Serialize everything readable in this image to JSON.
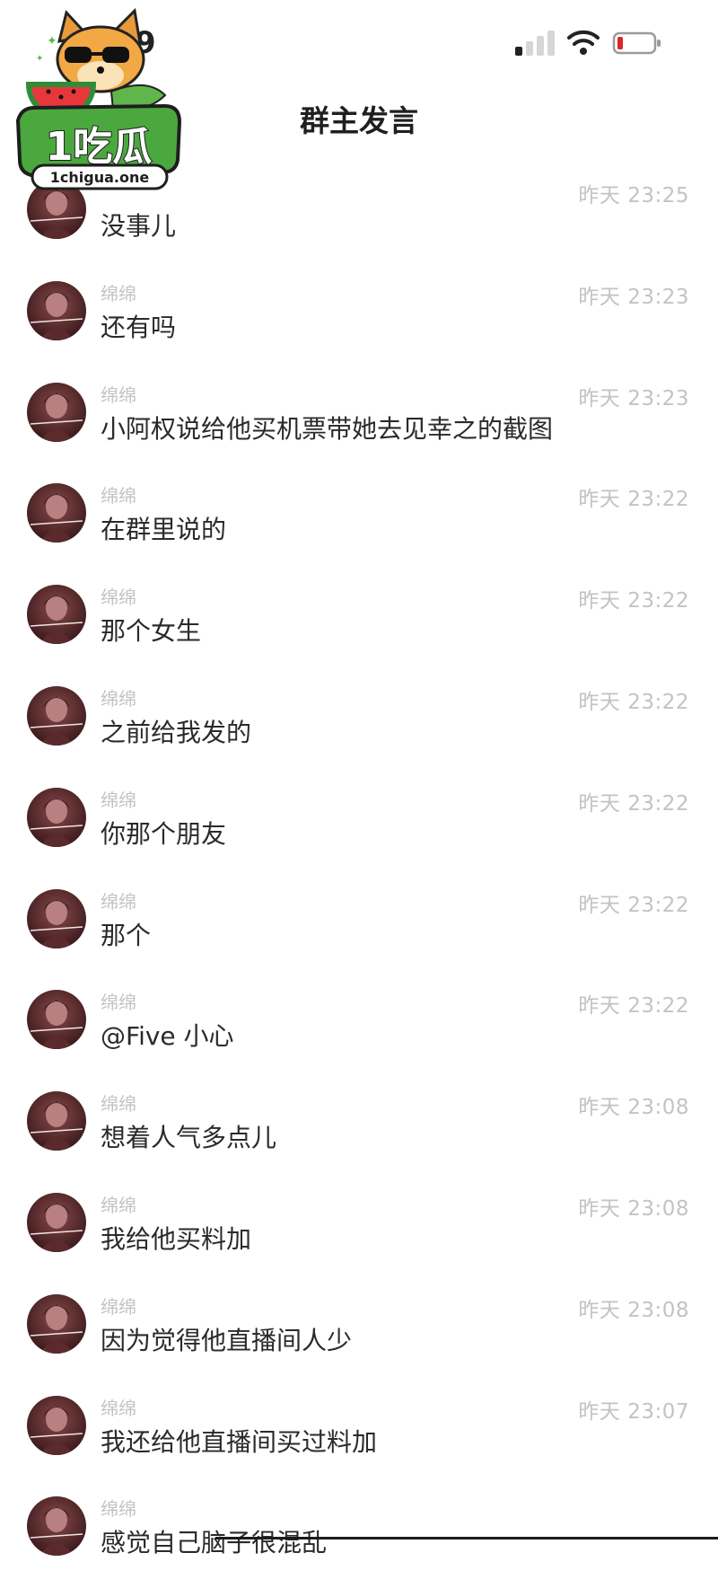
{
  "status_bar": {
    "time": "9"
  },
  "header": {
    "title": "群主发言"
  },
  "watermark": {
    "text": "1吃瓜",
    "url": "1chigua.one"
  },
  "messages": [
    {
      "sender": "",
      "time": "昨天 23:25",
      "text": "没事儿"
    },
    {
      "sender": "绵绵",
      "time": "昨天 23:23",
      "text": "还有吗"
    },
    {
      "sender": "绵绵",
      "time": "昨天 23:23",
      "text": "小阿权说给他买机票带她去见幸之的截图"
    },
    {
      "sender": "绵绵",
      "time": "昨天 23:22",
      "text": "在群里说的"
    },
    {
      "sender": "绵绵",
      "time": "昨天 23:22",
      "text": "那个女生"
    },
    {
      "sender": "绵绵",
      "time": "昨天 23:22",
      "text": "之前给我发的"
    },
    {
      "sender": "绵绵",
      "time": "昨天 23:22",
      "text": "你那个朋友"
    },
    {
      "sender": "绵绵",
      "time": "昨天 23:22",
      "text": "那个"
    },
    {
      "sender": "绵绵",
      "time": "昨天 23:22",
      "text": "@Five 小心"
    },
    {
      "sender": "绵绵",
      "time": "昨天 23:08",
      "text": "想着人气多点儿"
    },
    {
      "sender": "绵绵",
      "time": "昨天 23:08",
      "text": "我给他买料加"
    },
    {
      "sender": "绵绵",
      "time": "昨天 23:08",
      "text": "因为觉得他直播间人少"
    },
    {
      "sender": "绵绵",
      "time": "昨天 23:07",
      "text": "我还给他直播间买过料加"
    },
    {
      "sender": "绵绵",
      "time": "",
      "text": "感觉自己脑子很混乱"
    }
  ]
}
